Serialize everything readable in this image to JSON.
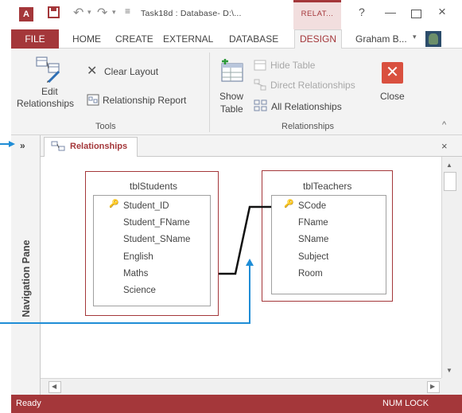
{
  "window": {
    "title": "Task18d : Database- D:\\...",
    "context_tab": "RELAT...",
    "help": "?",
    "minimize": "—",
    "close": "×",
    "app_logo": "A"
  },
  "ribbon_tabs": {
    "file": "FILE",
    "home": "HOME",
    "create": "CREATE",
    "external": "EXTERNAL",
    "database": "DATABASE",
    "design": "DESIGN",
    "user": "Graham B..."
  },
  "ribbon": {
    "edit_relationships_line1": "Edit",
    "edit_relationships_line2": "Relationships",
    "clear_layout": "Clear Layout",
    "relationship_report": "Relationship Report",
    "tools_group": "Tools",
    "show_table_line1": "Show",
    "show_table_line2": "Table",
    "hide_table": "Hide Table",
    "direct_relationships": "Direct Relationships",
    "all_relationships": "All Relationships",
    "close_line": "Close",
    "relationships_group": "Relationships",
    "collapse": "^"
  },
  "nav": {
    "toggle": "»",
    "label": "Navigation Pane"
  },
  "document_tab": {
    "label": "Relationships",
    "close": "×"
  },
  "tables": [
    {
      "name": "tblStudents",
      "key_field": "Student_ID",
      "fields": [
        "Student_FName",
        "Student_SName",
        "English",
        "Maths",
        "Science"
      ]
    },
    {
      "name": "tblTeachers",
      "key_field": "SCode",
      "fields": [
        "FName",
        "SName",
        "Subject",
        "Room"
      ]
    }
  ],
  "status": {
    "left": "Ready",
    "right": "NUM LOCK"
  },
  "colors": {
    "accent": "#a4373a",
    "callout": "#1f8dd6"
  }
}
